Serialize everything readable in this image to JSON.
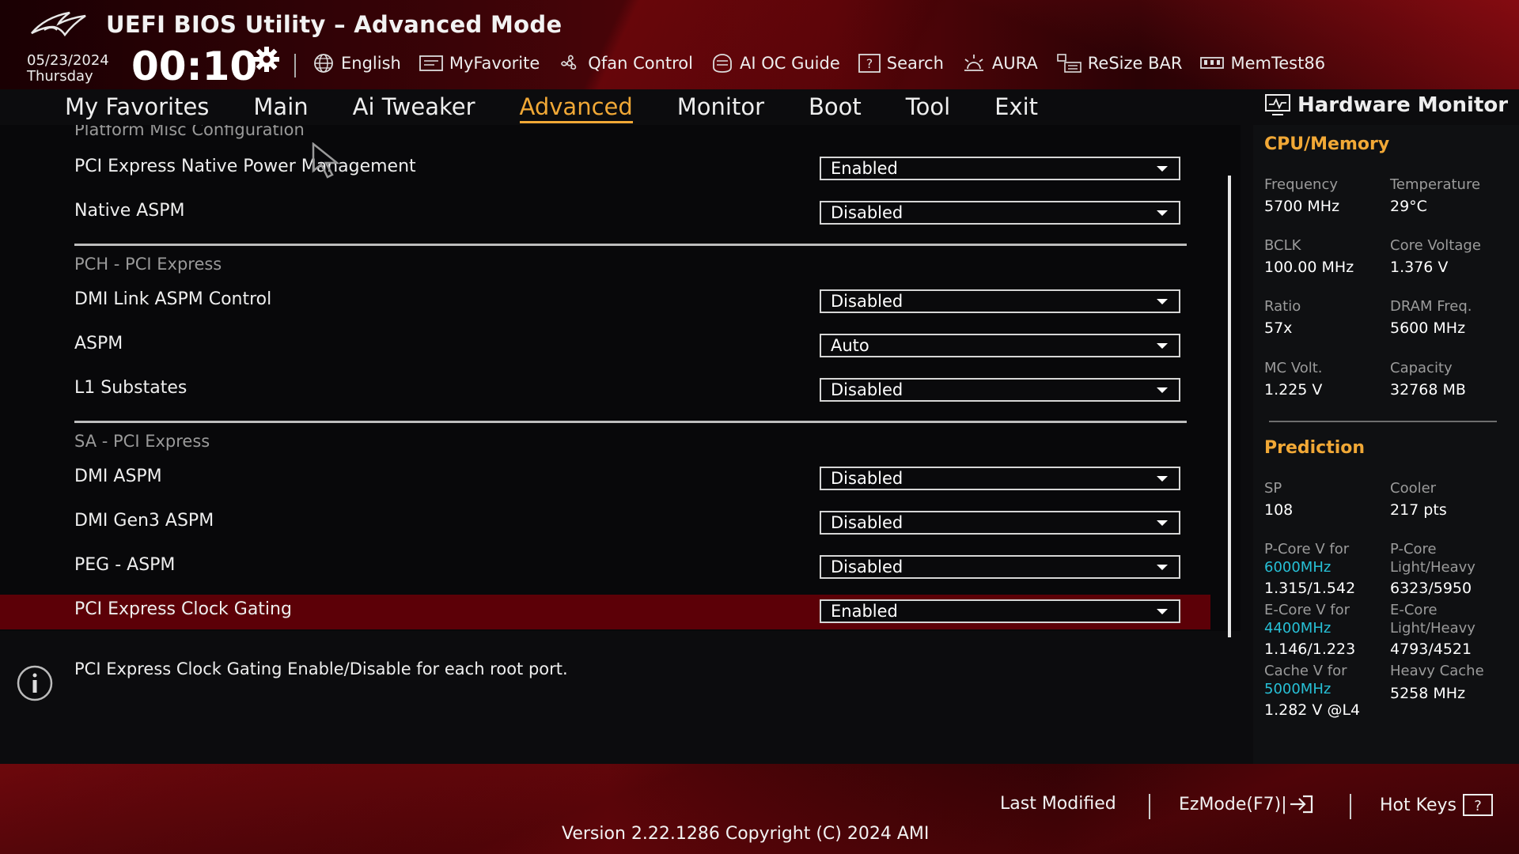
{
  "header": {
    "title": "UEFI BIOS Utility – Advanced Mode",
    "date": "05/23/2024",
    "day": "Thursday",
    "time": "00:10"
  },
  "toolbar": [
    {
      "label": "English",
      "icon": "globe-icon"
    },
    {
      "label": "MyFavorite",
      "icon": "favorite-icon"
    },
    {
      "label": "Qfan Control",
      "icon": "fan-icon"
    },
    {
      "label": "AI OC Guide",
      "icon": "ai-guide-icon"
    },
    {
      "label": "Search",
      "icon": "search-icon"
    },
    {
      "label": "AURA",
      "icon": "aura-icon"
    },
    {
      "label": "ReSize BAR",
      "icon": "resize-bar-icon"
    },
    {
      "label": "MemTest86",
      "icon": "memtest-icon"
    }
  ],
  "nav": {
    "tabs": [
      "My Favorites",
      "Main",
      "Ai Tweaker",
      "Advanced",
      "Monitor",
      "Boot",
      "Tool",
      "Exit"
    ],
    "active": "Advanced"
  },
  "settings": {
    "scrolled_title": "Platform Misc Configuration",
    "rows": [
      {
        "label": "PCI Express Native Power Management",
        "value": "Enabled"
      },
      {
        "label": "Native ASPM",
        "value": "Disabled"
      }
    ],
    "sections": [
      {
        "title": "PCH - PCI Express",
        "rows": [
          {
            "label": "DMI Link ASPM Control",
            "value": "Disabled"
          },
          {
            "label": "ASPM",
            "value": "Auto"
          },
          {
            "label": "L1 Substates",
            "value": "Disabled"
          }
        ]
      },
      {
        "title": "SA - PCI Express",
        "rows": [
          {
            "label": "DMI ASPM",
            "value": "Disabled"
          },
          {
            "label": "DMI Gen3 ASPM",
            "value": "Disabled"
          },
          {
            "label": "PEG - ASPM",
            "value": "Disabled"
          },
          {
            "label": "PCI Express Clock Gating",
            "value": "Enabled"
          }
        ]
      }
    ]
  },
  "help": {
    "text": "PCI Express Clock Gating Enable/Disable for each root port."
  },
  "hardware_monitor": {
    "title": "Hardware Monitor",
    "cpu_memory": {
      "title": "CPU/Memory",
      "items": [
        {
          "label": "Frequency",
          "value": "5700 MHz"
        },
        {
          "label": "Temperature",
          "value": "29°C"
        },
        {
          "label": "BCLK",
          "value": "100.00 MHz"
        },
        {
          "label": "Core Voltage",
          "value": "1.376 V"
        },
        {
          "label": "Ratio",
          "value": "57x"
        },
        {
          "label": "DRAM Freq.",
          "value": "5600 MHz"
        },
        {
          "label": "MC Volt.",
          "value": "1.225 V"
        },
        {
          "label": "Capacity",
          "value": "32768 MB"
        }
      ]
    },
    "prediction": {
      "title": "Prediction",
      "sp_label": "SP",
      "sp_value": "108",
      "cooler_label": "Cooler",
      "cooler_value": "217 pts",
      "pcore_label": "P-Core V for",
      "pcore_freq": "6000MHz",
      "pcore_value": "1.315/1.542",
      "pcore_lh_label_1": "P-Core",
      "pcore_lh_label_2": "Light/Heavy",
      "pcore_lh_value": "6323/5950",
      "ecore_label": "E-Core V for",
      "ecore_freq": "4400MHz",
      "ecore_value": "1.146/1.223",
      "ecore_lh_label_1": "E-Core",
      "ecore_lh_label_2": "Light/Heavy",
      "ecore_lh_value": "4793/4521",
      "cache_label": "Cache V for",
      "cache_freq": "5000MHz",
      "cache_value": "1.282 V @L4",
      "heavy_cache_label": "Heavy Cache",
      "heavy_cache_value": "5258 MHz"
    }
  },
  "footer": {
    "last_modified": "Last Modified",
    "ezmode": "EzMode(F7)|",
    "hotkeys": "Hot Keys",
    "version": "Version 2.22.1286 Copyright (C) 2024 AMI"
  },
  "colors": {
    "accent": "#f1a836",
    "selected_row": "#5c0007",
    "freq_highlight": "#27c0d6"
  }
}
